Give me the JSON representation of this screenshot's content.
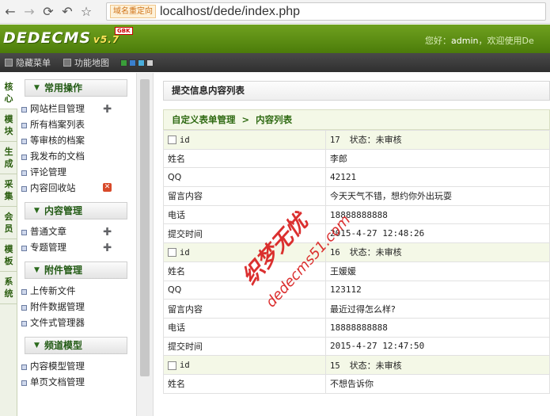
{
  "browser": {
    "redirect_tag": "域名重定向",
    "url": "localhost/dede/index.php"
  },
  "header": {
    "logo": "DEDECMS",
    "version": "v5.7",
    "badge": "GBK",
    "welcome_prefix": "您好：",
    "user": "admin",
    "welcome_suffix": "，欢迎使用De"
  },
  "toolbar": {
    "hide_menu": "隐藏菜单",
    "site_map": "功能地图",
    "skin_colors": [
      "#3a9e3a",
      "#3a7fcc",
      "#4aaedc",
      "#cfcfcf"
    ]
  },
  "left_tabs": [
    "核心",
    "模块",
    "生成",
    "采集",
    "会员",
    "模板",
    "系统"
  ],
  "menu": [
    {
      "title": "常用操作",
      "items": [
        {
          "label": "网站栏目管理",
          "add": true
        },
        {
          "label": "所有档案列表"
        },
        {
          "label": "等审核的档案"
        },
        {
          "label": "我发布的文档"
        },
        {
          "label": "评论管理"
        },
        {
          "label": "内容回收站",
          "remove": true
        }
      ]
    },
    {
      "title": "内容管理",
      "items": [
        {
          "label": "普通文章",
          "add": true
        },
        {
          "label": "专题管理",
          "add": true
        }
      ]
    },
    {
      "title": "附件管理",
      "items": [
        {
          "label": "上传新文件"
        },
        {
          "label": "附件数据管理"
        },
        {
          "label": "文件式管理器"
        }
      ]
    },
    {
      "title": "频道模型",
      "items": [
        {
          "label": "内容模型管理"
        },
        {
          "label": "单页文档管理"
        }
      ]
    }
  ],
  "main": {
    "title": "提交信息内容列表",
    "crumb_root": "自定义表单管理",
    "crumb_sep": ">",
    "crumb_current": "内容列表",
    "id_label": "id",
    "status_label": "状态：",
    "fields": {
      "name": "姓名",
      "qq": "QQ",
      "message": "留言内容",
      "phone": "电话",
      "time": "提交时间"
    },
    "records": [
      {
        "id": "17",
        "status": "未审核",
        "name": "李郎",
        "qq": "42121",
        "message": "今天天气不错，想约你外出玩耍",
        "phone": "18888888888",
        "time": "2015-4-27 12:48:26"
      },
      {
        "id": "16",
        "status": "未审核",
        "name": "王媛媛",
        "qq": "123112",
        "message": "最近过得怎么样?",
        "phone": "18888888888",
        "time": "2015-4-27 12:47:50"
      },
      {
        "id": "15",
        "status": "未审核",
        "name": "不想告诉你"
      }
    ]
  },
  "watermark": {
    "line1": "织梦无忧",
    "line2": "dedecms51.com"
  }
}
